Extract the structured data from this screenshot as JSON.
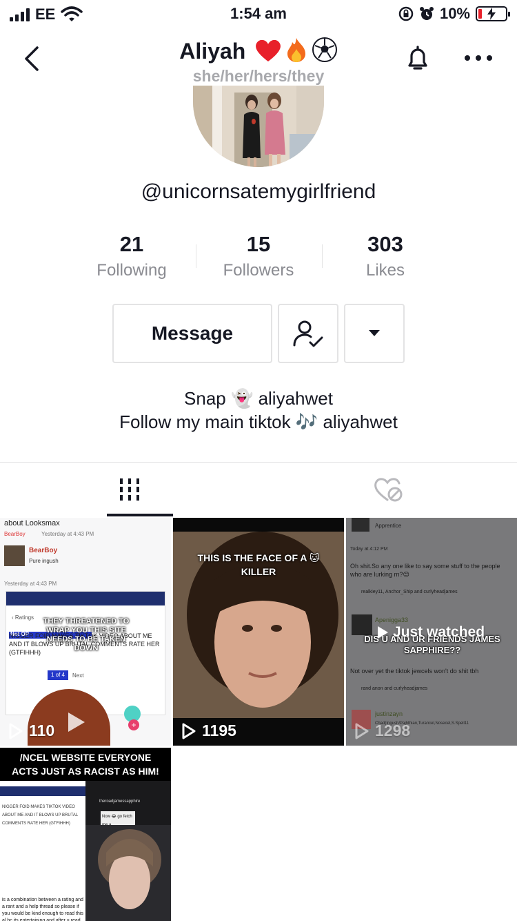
{
  "status": {
    "carrier": "EE",
    "time": "1:54 am",
    "battery": "10%"
  },
  "header": {
    "title": "Aliyah",
    "title_emoji": "❤️🔥⚽",
    "pronouns": "she/her/hers/they"
  },
  "profile": {
    "username": "@unicornsatemygirlfriend"
  },
  "stats": [
    {
      "value": "21",
      "label": "Following"
    },
    {
      "value": "15",
      "label": "Followers"
    },
    {
      "value": "303",
      "label": "Likes"
    }
  ],
  "actions": {
    "message_label": "Message"
  },
  "bio": {
    "line1": "Snap 👻 aliyahwet",
    "line2": "Follow my main tiktok 🎶 aliyahwet"
  },
  "videos": [
    {
      "views": "110",
      "header": "about Looksmax",
      "author": "BearBoy",
      "author_meta": "Yesterday at 4:43 PM",
      "author_sub": "Pure ingush",
      "timestamp": "Yesterday at 4:43 PM",
      "caption": "THEY THREATENED TO WRAP YOU THIS SITE NEEDS TO BE TAKEN DOWN",
      "thread_title": "NIGGER FOID MAKES TIKTOK VIDEO ABOUT ME AND IT BLOWS UP BRUTAL COMMENTS RATE HER (GTFIHHH)",
      "badge": "Not OP",
      "pager": "1 of 4",
      "next": "Next"
    },
    {
      "views": "1195",
      "caption": "THIS IS THE FACE OF A 🐱 KILLER"
    },
    {
      "views": "1298",
      "label": "Just watched",
      "caption": "DIS U AND UR FRIENDS JAMES SAPPHIRE??",
      "rank": "Apprentice",
      "post1": "Oh shit.So any one like to say some stuff to the people who are lurking rn?😊",
      "post1_meta": "realkiey11, Anchor_Ship and curlyheadjames",
      "user2": "Apenigga33",
      "post2": "Not over yet the tiktok jewcels won't do shit tbh",
      "post2_meta": "rand anon and curlyheadjames",
      "user3": "justinzayn",
      "user3_meta": "Chad(Ingush/Pajhthian,Turancel,Nosecel,S.Spell11",
      "timestamp": "Today at 4:12 PM"
    },
    {
      "caption": "/NCEL WEBSITE EVERYONE ACTS JUST AS RACIST AS HIM!",
      "left_text": "is a combination between a rating and a rant and a help thread so please if you would be kind enough to read this al bc its entertaining and after u read it if you want to see all the e videos these",
      "dm": "Now 😂 go fetch me a watermelon 🍉",
      "account": "theroadjamessapphire"
    }
  ],
  "colors": {
    "accent": "#161823",
    "secondary": "#8a8b91",
    "heart": "#e8202a"
  }
}
